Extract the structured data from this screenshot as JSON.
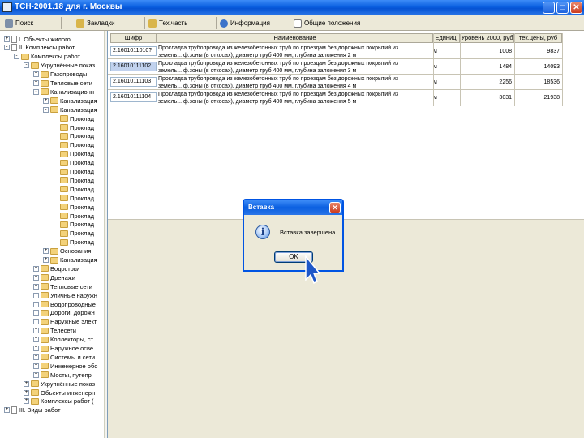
{
  "window": {
    "title": "ТСН-2001.18 для г. Москвы",
    "buttons": {
      "minimize": "_",
      "maximize": "□",
      "close": "✕"
    }
  },
  "toolbar": [
    {
      "label": "Поиск",
      "icon": "binoculars-icon"
    },
    {
      "label": "Закладки",
      "icon": "pencil-icon"
    },
    {
      "label": "Тех.часть",
      "icon": "pencil-icon"
    },
    {
      "label": "Информация",
      "icon": "info-icon"
    },
    {
      "label": "Общие положения",
      "icon": "document-icon"
    }
  ],
  "tree": {
    "items": [
      {
        "label": "I. Объекты жилого",
        "level": 0,
        "expander": "+",
        "icon": "doc"
      },
      {
        "label": "II. Комплексы работ",
        "level": 0,
        "expander": "-",
        "icon": "doc"
      },
      {
        "label": "Комплексы работ",
        "level": 1,
        "expander": "-",
        "icon": "folder"
      },
      {
        "label": "Укрупнённые показ",
        "level": 2,
        "expander": "-",
        "icon": "folder"
      },
      {
        "label": "Газопроводы",
        "level": 3,
        "expander": "+",
        "icon": "folder"
      },
      {
        "label": "Тепловые сети",
        "level": 3,
        "expander": "+",
        "icon": "folder"
      },
      {
        "label": "Канализационн",
        "level": 3,
        "expander": "-",
        "icon": "folder"
      },
      {
        "label": "Канализация",
        "level": 4,
        "expander": "+",
        "icon": "folder"
      },
      {
        "label": "Канализация",
        "level": 4,
        "expander": "-",
        "icon": "folder"
      },
      {
        "label": "Проклад",
        "level": 5,
        "expander": "",
        "icon": "folder-edit"
      },
      {
        "label": "Проклад",
        "level": 5,
        "expander": "",
        "icon": "folder"
      },
      {
        "label": "Проклад",
        "level": 5,
        "expander": "",
        "icon": "folder"
      },
      {
        "label": "Проклад",
        "level": 5,
        "expander": "",
        "icon": "folder"
      },
      {
        "label": "Проклад",
        "level": 5,
        "expander": "",
        "icon": "folder"
      },
      {
        "label": "Проклад",
        "level": 5,
        "expander": "",
        "icon": "folder"
      },
      {
        "label": "Проклад",
        "level": 5,
        "expander": "",
        "icon": "folder"
      },
      {
        "label": "Проклад",
        "level": 5,
        "expander": "",
        "icon": "folder"
      },
      {
        "label": "Проклад",
        "level": 5,
        "expander": "",
        "icon": "folder"
      },
      {
        "label": "Проклад",
        "level": 5,
        "expander": "",
        "icon": "folder"
      },
      {
        "label": "Проклад",
        "level": 5,
        "expander": "",
        "icon": "folder"
      },
      {
        "label": "Проклад",
        "level": 5,
        "expander": "",
        "icon": "folder"
      },
      {
        "label": "Проклад",
        "level": 5,
        "expander": "",
        "icon": "folder"
      },
      {
        "label": "Проклад",
        "level": 5,
        "expander": "",
        "icon": "folder"
      },
      {
        "label": "Проклад",
        "level": 5,
        "expander": "",
        "icon": "folder"
      },
      {
        "label": "Основания",
        "level": 4,
        "expander": "+",
        "icon": "folder"
      },
      {
        "label": "Канализация",
        "level": 4,
        "expander": "+",
        "icon": "folder"
      },
      {
        "label": "Водостоки",
        "level": 3,
        "expander": "+",
        "icon": "folder"
      },
      {
        "label": "Дренажи",
        "level": 3,
        "expander": "+",
        "icon": "folder"
      },
      {
        "label": "Тепловые сети",
        "level": 3,
        "expander": "+",
        "icon": "folder"
      },
      {
        "label": "Уличные наружн",
        "level": 3,
        "expander": "+",
        "icon": "folder"
      },
      {
        "label": "Водопроводные",
        "level": 3,
        "expander": "+",
        "icon": "folder"
      },
      {
        "label": "Дороги, дорожн",
        "level": 3,
        "expander": "+",
        "icon": "folder"
      },
      {
        "label": "Наружные элект",
        "level": 3,
        "expander": "+",
        "icon": "folder"
      },
      {
        "label": "Телесети",
        "level": 3,
        "expander": "+",
        "icon": "folder"
      },
      {
        "label": "Коллекторы, ст",
        "level": 3,
        "expander": "+",
        "icon": "folder"
      },
      {
        "label": "Наружное осве",
        "level": 3,
        "expander": "+",
        "icon": "folder"
      },
      {
        "label": "Системы и сети",
        "level": 3,
        "expander": "+",
        "icon": "folder"
      },
      {
        "label": "Инженерное обо",
        "level": 3,
        "expander": "+",
        "icon": "folder"
      },
      {
        "label": "Мосты, путепр",
        "level": 3,
        "expander": "+",
        "icon": "folder"
      },
      {
        "label": "Укрупнённые показ",
        "level": 2,
        "expander": "+",
        "icon": "folder"
      },
      {
        "label": "Объекты инженерн",
        "level": 2,
        "expander": "+",
        "icon": "folder"
      },
      {
        "label": "Комплексы работ (",
        "level": 2,
        "expander": "+",
        "icon": "folder"
      },
      {
        "label": "III. Виды работ",
        "level": 0,
        "expander": "+",
        "icon": "doc"
      }
    ]
  },
  "grid": {
    "columns": [
      "Шифр",
      "Наименование",
      "Единиц.",
      "Уровень 2000, руб",
      "тек.цены, руб"
    ],
    "rows": [
      {
        "code": "2.1601011010?",
        "name1": "Прокладка трубопровода из железобетонных труб по проездам без дорожных покрытий из",
        "name2": "земель... ф.зоны (в откосах), диаметр труб 400 мм, глубина заложения 2 м",
        "unit": "м",
        "price2000": "1008",
        "current": "9837"
      },
      {
        "code": "2.16010111102",
        "name1": "Прокладка трубопровода из железобетонных труб по проездам без дорожных покрытий из",
        "name2": "земель... ф.зоны (в откосах), диаметр труб 400 мм, глубина заложения 3 м",
        "unit": "м",
        "price2000": "1484",
        "current": "14093"
      },
      {
        "code": "2.16010111103",
        "name1": "Прокладка трубопровода из железобетонных труб по проездам без дорожных покрытий из",
        "name2": "земель... ф.зоны (в откосах), диаметр труб 400 мм, глубина заложения 4 м",
        "unit": "м",
        "price2000": "2256",
        "current": "18536"
      },
      {
        "code": "2.16010111104",
        "name1": "Прокладка трубопровода из железобетонных труб по проездам без дорожных покрытий из",
        "name2": "земель... ф.зоны (в откосах), диаметр труб 400 мм, глубина заложения 5 м",
        "unit": "м",
        "price2000": "3031",
        "current": "21938"
      }
    ]
  },
  "dialog": {
    "title": "Вставка",
    "message": "Вставка завершена",
    "ok": "OK",
    "close": "✕",
    "icon_glyph": "i"
  }
}
